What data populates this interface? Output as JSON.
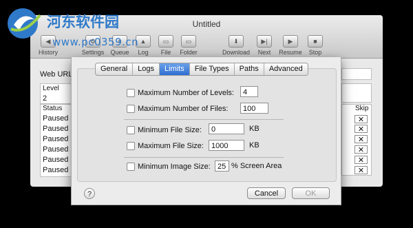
{
  "window": {
    "title": "Untitled"
  },
  "toolbar": {
    "history": "History",
    "settings": "Settings",
    "queue": "Queue",
    "log": "Log",
    "file": "File",
    "folder": "Folder",
    "download": "Download",
    "next": "Next",
    "resume": "Resume",
    "stop": "Stop"
  },
  "main": {
    "web_url_label": "Web URL:",
    "level_header": "Level",
    "level_value": "2",
    "status_header": "Status",
    "skip_header": "Skip",
    "rows": [
      "Paused",
      "Paused",
      "Paused",
      "Paused",
      "Paused",
      "Paused"
    ]
  },
  "sheet": {
    "tabs": [
      "General",
      "Logs",
      "Limits",
      "File Types",
      "Paths",
      "Advanced"
    ],
    "active_tab": "Limits",
    "max_levels": {
      "label": "Maximum Number of Levels:",
      "value": "4"
    },
    "max_files": {
      "label": "Maximum Number of Files:",
      "value": "100"
    },
    "min_file_size": {
      "label": "Minimum File Size:",
      "value": "0",
      "unit": "KB"
    },
    "max_file_size": {
      "label": "Maximum File Size:",
      "value": "1000",
      "unit": "KB"
    },
    "min_image_size": {
      "label": "Minimum Image Size:",
      "value": "25",
      "unit": "% Screen Area"
    },
    "help": "?",
    "cancel": "Cancel",
    "ok": "OK"
  },
  "watermark": {
    "site_name": "河东软件园",
    "url": "www.pc0359.cn"
  }
}
